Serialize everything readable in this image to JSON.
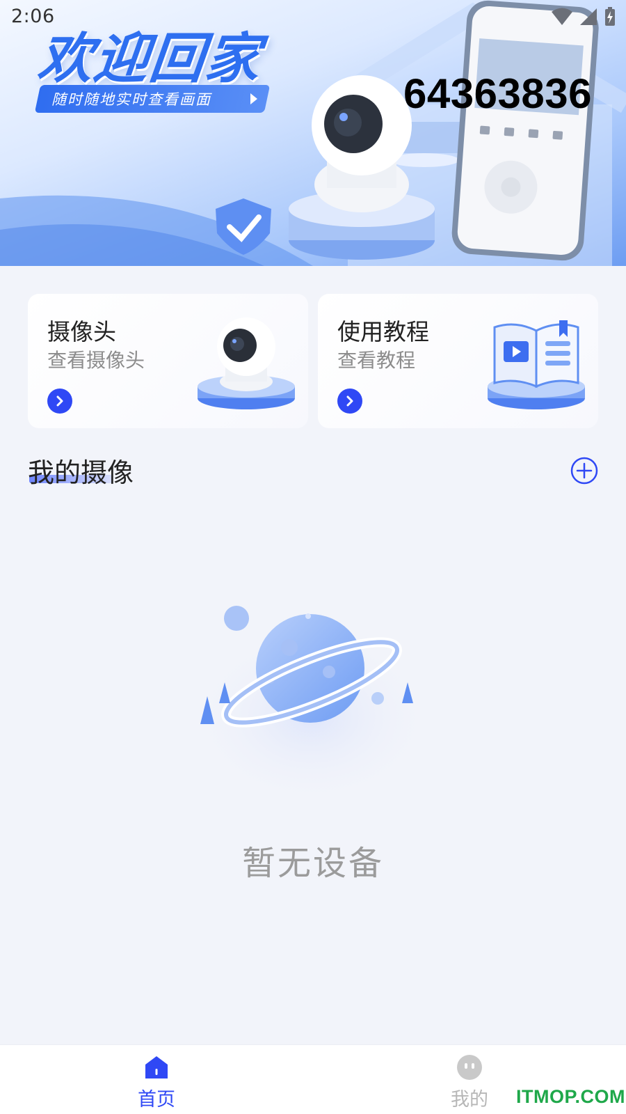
{
  "status_bar": {
    "time": "2:06",
    "icons": [
      "wifi-icon",
      "cellular-signal-icon",
      "battery-charging-icon"
    ]
  },
  "banner": {
    "title": "欢迎回家",
    "subtitle": "随时随地实时查看画面",
    "number": "64363836"
  },
  "cards": [
    {
      "title": "摄像头",
      "subtitle": "查看摄像头",
      "icon": "camera-illustration"
    },
    {
      "title": "使用教程",
      "subtitle": "查看教程",
      "icon": "tutorial-book-illustration"
    }
  ],
  "section": {
    "title": "我的摄像",
    "add_icon": "plus-circle-icon"
  },
  "empty_state": {
    "text": "暂无设备",
    "icon": "planet-illustration"
  },
  "bottom_nav": {
    "items": [
      {
        "label": "首页",
        "icon": "home-icon",
        "active": true
      },
      {
        "label": "我的",
        "icon": "profile-face-icon",
        "active": false
      }
    ]
  },
  "watermark": "ITMOP.COM",
  "colors": {
    "accent": "#2f48f5",
    "banner_blue": "#2e6ff0",
    "background": "#f2f4fa",
    "watermark_green": "#1fa84a"
  }
}
